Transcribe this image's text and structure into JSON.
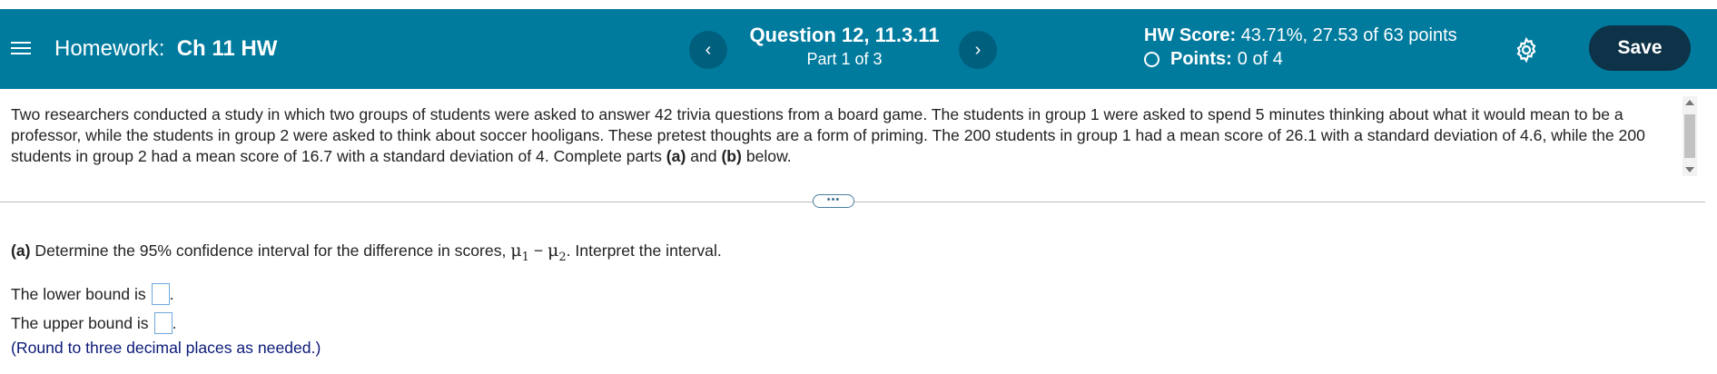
{
  "header": {
    "menu_icon": "hamburger-menu-icon",
    "hw_prefix": "Homework:",
    "hw_name": "Ch 11 HW",
    "question_title": "Question 12, 11.3.11",
    "question_part": "Part 1 of 3",
    "prev_glyph": "‹",
    "next_glyph": "›",
    "score_label": "HW Score:",
    "score_value": "43.71%, 27.53 of 63 points",
    "points_label": "Points:",
    "points_value": "0 of 4",
    "settings_icon": "gear-icon",
    "save_label": "Save",
    "colors": {
      "header_bg": "#007b9e",
      "save_bg": "#0e3247",
      "nav_bg": "#005f7d"
    }
  },
  "question": {
    "stem": "Two researchers conducted a study in which two groups of students were asked to answer 42  trivia questions from a board game. The students in group 1 were asked to spend 5 minutes thinking about what it would mean to be a professor, while the students in group 2 were asked to think about soccer hooligans. These pretest thoughts are a form of priming. The 200 students in group 1 had a mean score of 26.1 with a standard deviation of 4.6, while the 200 students in group 2 had a mean score of 16.7 with a standard deviation of 4. Complete parts",
    "part_a_ref": "(a)",
    "and_text": "and",
    "part_b_ref": "(b)",
    "below_text": "below.",
    "expander_label": "•••"
  },
  "part_a": {
    "label": "(a)",
    "text_before": "Determine the 95% confidence interval for the difference in scores,",
    "mu1": "μ",
    "sub1": "1",
    "minus": "−",
    "mu2": "μ",
    "sub2": "2",
    "text_after": ". Interpret the interval.",
    "lower_label": "The lower bound is",
    "upper_label": "The upper bound is",
    "lower_value": "",
    "upper_value": "",
    "hint": "(Round to three decimal places as needed.)"
  }
}
